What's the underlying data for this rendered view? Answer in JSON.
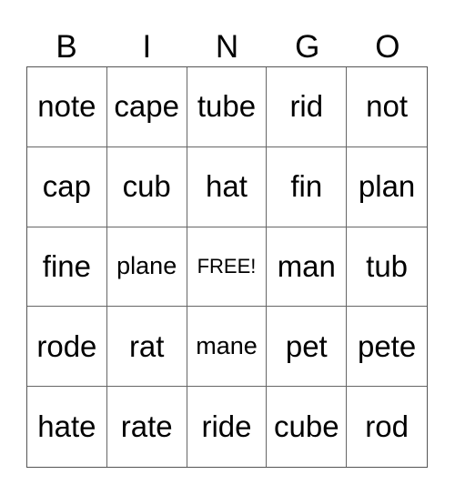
{
  "header": [
    "B",
    "I",
    "N",
    "G",
    "O"
  ],
  "rows": [
    [
      "note",
      "cape",
      "tube",
      "rid",
      "not"
    ],
    [
      "cap",
      "cub",
      "hat",
      "fin",
      "plan"
    ],
    [
      "fine",
      "plane",
      "FREE!",
      "man",
      "tub"
    ],
    [
      "rode",
      "rat",
      "mane",
      "pet",
      "pete"
    ],
    [
      "hate",
      "rate",
      "ride",
      "cube",
      "rod"
    ]
  ]
}
